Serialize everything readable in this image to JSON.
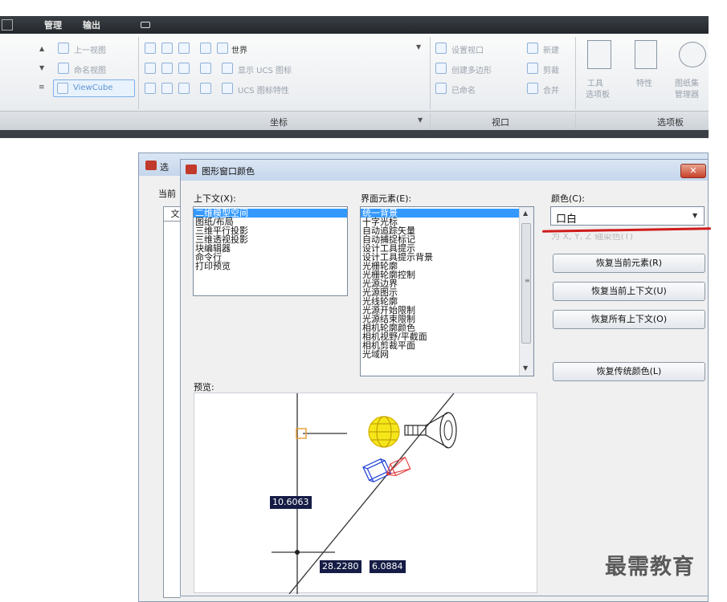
{
  "menubar": {
    "items": [
      "管理",
      "输出"
    ]
  },
  "ribbon": {
    "view_group": {
      "prev_view": "上一视图",
      "named_views": "命名视图",
      "viewcube": "ViewCube"
    },
    "coords_group": {
      "world": "世界",
      "show_ucs_icon": "显示 UCS 图标",
      "ucs_icon_props": "UCS 图标特性",
      "panel_label": "坐标"
    },
    "viewport_group": {
      "set_viewport": "设置视口",
      "new": "新建",
      "create_polygon": "创建多边形",
      "clip": "剪裁",
      "named": "已命名",
      "join": "合并",
      "panel_label": "视口"
    },
    "palettes_group": {
      "tool_palettes": [
        "工具",
        "选项板"
      ],
      "properties": "特性",
      "sheet_set": [
        "图纸集",
        "管理器"
      ],
      "panel_label": "选项板"
    }
  },
  "parent_dialog": {
    "title_partial": "选",
    "label_current": "当前",
    "tab_partial": "文"
  },
  "dialog": {
    "title": "图形窗口颜色",
    "close_label": "✕",
    "context": {
      "label": "上下文(X):",
      "items": [
        "二维模型空间",
        "图纸/布局",
        "三维平行投影",
        "三维透视投影",
        "块编辑器",
        "命令行",
        "打印预览"
      ],
      "selected_index": 0
    },
    "elements": {
      "label": "界面元素(E):",
      "items": [
        "统一背景",
        "十字光标",
        "自动追踪矢量",
        "自动捕捉标记",
        "设计工具提示",
        "设计工具提示背景",
        "光栅轮廓",
        "光栅轮廓控制",
        "光源边界",
        "光源图示",
        "光线轮廓",
        "光源开始限制",
        "光源结束限制",
        "相机轮廓颜色",
        "相机视野/平截面",
        "相机剪裁平面",
        "光域网"
      ],
      "selected_index": 0
    },
    "color": {
      "label": "颜色(C):",
      "value": "口白",
      "tint_checkbox_label": "为 X, Y, Z 轴染色(T)"
    },
    "buttons": {
      "restore_current_element": "恢复当前元素(R)",
      "restore_current_context": "恢复当前上下文(U)",
      "restore_all_contexts": "恢复所有上下文(O)",
      "restore_classic_colors": "恢复传统颜色(L)"
    },
    "preview": {
      "label": "预览:",
      "readout_y": "10.6063",
      "readout_x": "28.2280",
      "readout_z": "6.0884"
    }
  },
  "annotation": {
    "underline_color": "#d11a1a"
  },
  "watermark": "最需教育"
}
